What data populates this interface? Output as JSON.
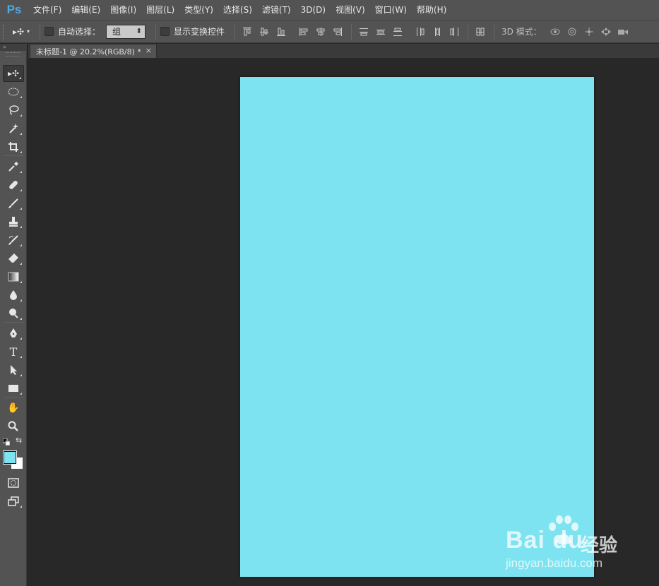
{
  "app": {
    "logo": "Ps",
    "menu": [
      "文件(F)",
      "编辑(E)",
      "图像(I)",
      "图层(L)",
      "类型(Y)",
      "选择(S)",
      "滤镜(T)",
      "3D(D)",
      "视图(V)",
      "窗口(W)",
      "帮助(H)"
    ]
  },
  "options": {
    "tool_icon": "move-tool-icon",
    "auto_select_label": "自动选择：",
    "auto_select_checked": false,
    "auto_select_target": "组",
    "show_transform_label": "显示变换控件",
    "show_transform_checked": false,
    "mode_label": "3D 模式："
  },
  "document": {
    "tab_title": "未标题-1 @ 20.2%(RGB/8) *",
    "close_glyph": "×",
    "canvas_color": "#7ee3f1"
  },
  "colors": {
    "foreground": "#7ee3f1",
    "background": "#ffffff"
  },
  "tools": [
    "move-tool",
    "elliptical-marquee-tool",
    "lasso-tool",
    "magic-wand-tool",
    "crop-tool",
    "eyedropper-tool",
    "healing-brush-tool",
    "brush-tool",
    "clone-stamp-tool",
    "history-brush-tool",
    "eraser-tool",
    "gradient-tool",
    "blur-tool",
    "dodge-tool",
    "pen-tool",
    "type-tool",
    "path-selection-tool",
    "rectangle-tool",
    "hand-tool",
    "zoom-tool"
  ],
  "watermark": {
    "brand": "Bai du",
    "cn": "经验",
    "url": "jingyan.baidu.com"
  }
}
